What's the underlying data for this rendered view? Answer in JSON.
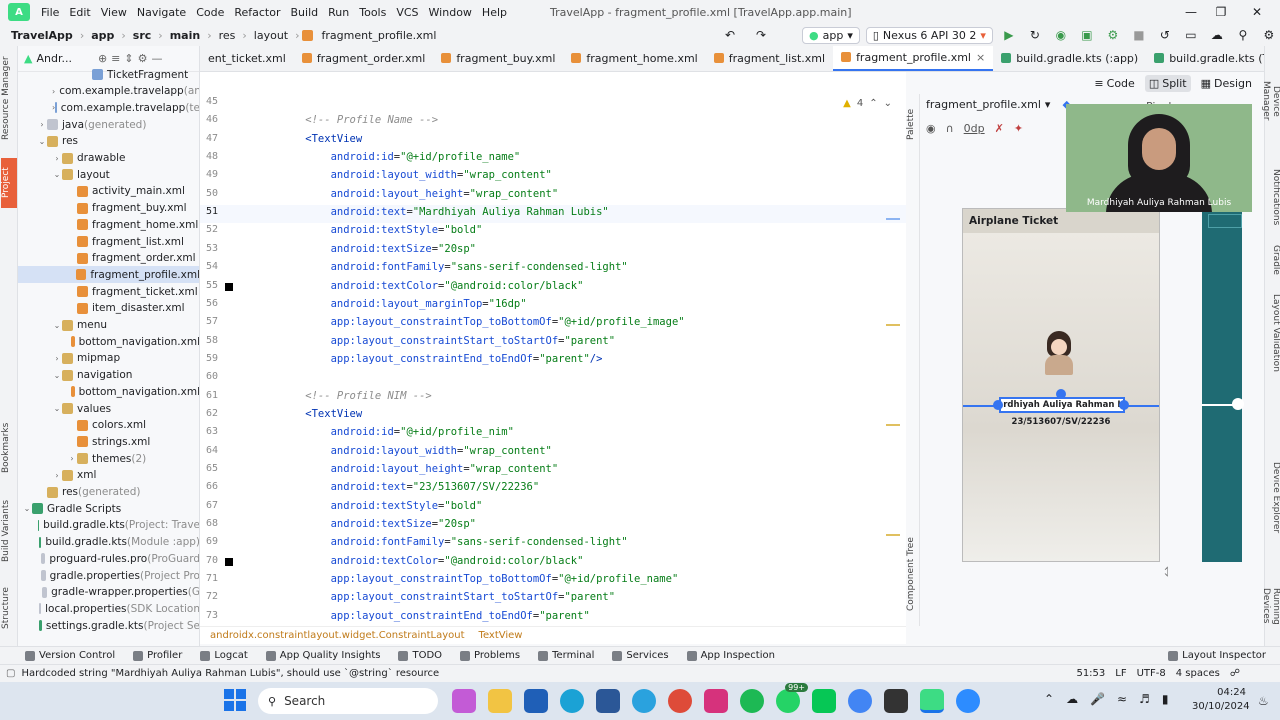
{
  "menubar": {
    "logo": "A",
    "items": [
      "File",
      "Edit",
      "View",
      "Navigate",
      "Code",
      "Refactor",
      "Build",
      "Run",
      "Tools",
      "VCS",
      "Window",
      "Help"
    ],
    "title": "TravelApp - fragment_profile.xml [TravelApp.app.main]"
  },
  "navbar": {
    "crumbs": [
      "TravelApp",
      "app",
      "src",
      "main",
      "res",
      "layout",
      "fragment_profile.xml"
    ],
    "run_config": "app",
    "device": "Nexus 6 API 30 2"
  },
  "project_panel": {
    "title": "Andr...",
    "rows": [
      {
        "label": "TicketFragment",
        "indent": 4,
        "icon": "pkg",
        "arrow": ""
      },
      {
        "label": "com.example.travelapp",
        "suffix": " (an",
        "indent": 2,
        "icon": "pkg",
        "arrow": ">"
      },
      {
        "label": "com.example.travelapp",
        "suffix": " (te",
        "indent": 2,
        "icon": "pkg",
        "arrow": ">"
      },
      {
        "label": "java",
        "suffix": " (generated)",
        "indent": 1,
        "icon": "javaf",
        "arrow": ">"
      },
      {
        "label": "res",
        "indent": 1,
        "icon": "folder",
        "arrow": "v"
      },
      {
        "label": "drawable",
        "indent": 2,
        "icon": "folder",
        "arrow": ">"
      },
      {
        "label": "layout",
        "indent": 2,
        "icon": "folder",
        "arrow": "v"
      },
      {
        "label": "activity_main.xml",
        "indent": 3,
        "icon": "xmlf",
        "arrow": ""
      },
      {
        "label": "fragment_buy.xml",
        "indent": 3,
        "icon": "xmlf",
        "arrow": ""
      },
      {
        "label": "fragment_home.xml",
        "indent": 3,
        "icon": "xmlf",
        "arrow": ""
      },
      {
        "label": "fragment_list.xml",
        "indent": 3,
        "icon": "xmlf",
        "arrow": ""
      },
      {
        "label": "fragment_order.xml",
        "indent": 3,
        "icon": "xmlf",
        "arrow": ""
      },
      {
        "label": "fragment_profile.xml",
        "indent": 3,
        "icon": "xmlf",
        "arrow": "",
        "selected": true
      },
      {
        "label": "fragment_ticket.xml",
        "indent": 3,
        "icon": "xmlf",
        "arrow": ""
      },
      {
        "label": "item_disaster.xml",
        "indent": 3,
        "icon": "xmlf",
        "arrow": ""
      },
      {
        "label": "menu",
        "indent": 2,
        "icon": "folder",
        "arrow": "v"
      },
      {
        "label": "bottom_navigation.xml",
        "indent": 3,
        "icon": "xmlf",
        "arrow": ""
      },
      {
        "label": "mipmap",
        "indent": 2,
        "icon": "folder",
        "arrow": ">"
      },
      {
        "label": "navigation",
        "indent": 2,
        "icon": "folder",
        "arrow": "v"
      },
      {
        "label": "bottom_navigation.xml",
        "indent": 3,
        "icon": "xmlf",
        "arrow": ""
      },
      {
        "label": "values",
        "indent": 2,
        "icon": "folder",
        "arrow": "v"
      },
      {
        "label": "colors.xml",
        "indent": 3,
        "icon": "xmlf",
        "arrow": ""
      },
      {
        "label": "strings.xml",
        "indent": 3,
        "icon": "xmlf",
        "arrow": ""
      },
      {
        "label": "themes",
        "suffix": " (2)",
        "indent": 3,
        "icon": "folder",
        "arrow": ">"
      },
      {
        "label": "xml",
        "indent": 2,
        "icon": "folder",
        "arrow": ">"
      },
      {
        "label": "res",
        "suffix": " (generated)",
        "indent": 1,
        "icon": "folder",
        "arrow": ""
      },
      {
        "label": "Gradle Scripts",
        "indent": 0,
        "icon": "gradlef",
        "arrow": "v"
      },
      {
        "label": "build.gradle.kts",
        "suffix": " (Project: Trave",
        "indent": 1,
        "icon": "gradlef",
        "arrow": ""
      },
      {
        "label": "build.gradle.kts",
        "suffix": " (Module :app)",
        "indent": 1,
        "icon": "gradlef",
        "arrow": ""
      },
      {
        "label": "proguard-rules.pro",
        "suffix": " (ProGuard",
        "indent": 1,
        "icon": "javaf",
        "arrow": ""
      },
      {
        "label": "gradle.properties",
        "suffix": " (Project Pro",
        "indent": 1,
        "icon": "javaf",
        "arrow": ""
      },
      {
        "label": "gradle-wrapper.properties",
        "suffix": " (G",
        "indent": 1,
        "icon": "javaf",
        "arrow": ""
      },
      {
        "label": "local.properties",
        "suffix": " (SDK Location",
        "indent": 1,
        "icon": "javaf",
        "arrow": ""
      },
      {
        "label": "settings.gradle.kts",
        "suffix": " (Project Se",
        "indent": 1,
        "icon": "gradlef",
        "arrow": ""
      }
    ]
  },
  "left_strip": [
    "Resource Manager",
    "Project",
    "Bookmarks",
    "Build Variants",
    "Structure"
  ],
  "right_strip": [
    "Device Manager",
    "Notifications",
    "Gradle",
    "Layout Validation",
    "Device Explorer",
    "Running Devices"
  ],
  "tabs": [
    "ent_ticket.xml",
    "fragment_order.xml",
    "fragment_buy.xml",
    "fragment_home.xml",
    "fragment_list.xml",
    "fragment_profile.xml",
    "build.gradle.kts (:app)",
    "build.gradle.kts (TravelApp)"
  ],
  "active_tab": 5,
  "editor": {
    "warning_count": "4",
    "lines": [
      {
        "n": "45",
        "t": ""
      },
      {
        "n": "46",
        "t": "    <!-- Profile Name -->",
        "k": "cmt"
      },
      {
        "n": "47",
        "t": "    <TextView",
        "k": "tag"
      },
      {
        "n": "48",
        "t": "        android:id=\"@+id/profile_name\""
      },
      {
        "n": "49",
        "t": "        android:layout_width=\"wrap_content\""
      },
      {
        "n": "50",
        "t": "        android:layout_height=\"wrap_content\""
      },
      {
        "n": "51",
        "t": "        android:text=\"Mardhiyah Auliya Rahman Lubis\"",
        "cur": true
      },
      {
        "n": "52",
        "t": "        android:textStyle=\"bold\""
      },
      {
        "n": "53",
        "t": "        android:textSize=\"20sp\""
      },
      {
        "n": "54",
        "t": "        android:fontFamily=\"sans-serif-condensed-light\""
      },
      {
        "n": "55",
        "t": "        android:textColor=\"@android:color/black\"",
        "mark": true
      },
      {
        "n": "56",
        "t": "        android:layout_marginTop=\"16dp\""
      },
      {
        "n": "57",
        "t": "        app:layout_constraintTop_toBottomOf=\"@+id/profile_image\""
      },
      {
        "n": "58",
        "t": "        app:layout_constraintStart_toStartOf=\"parent\""
      },
      {
        "n": "59",
        "t": "        app:layout_constraintEnd_toEndOf=\"parent\"/>"
      },
      {
        "n": "60",
        "t": ""
      },
      {
        "n": "61",
        "t": "    <!-- Profile NIM -->",
        "k": "cmt"
      },
      {
        "n": "62",
        "t": "    <TextView",
        "k": "tag"
      },
      {
        "n": "63",
        "t": "        android:id=\"@+id/profile_nim\""
      },
      {
        "n": "64",
        "t": "        android:layout_width=\"wrap_content\""
      },
      {
        "n": "65",
        "t": "        android:layout_height=\"wrap_content\""
      },
      {
        "n": "66",
        "t": "        android:text=\"23/513607/SV/22236\""
      },
      {
        "n": "67",
        "t": "        android:textStyle=\"bold\""
      },
      {
        "n": "68",
        "t": "        android:textSize=\"20sp\""
      },
      {
        "n": "69",
        "t": "        android:fontFamily=\"sans-serif-condensed-light\""
      },
      {
        "n": "70",
        "t": "        android:textColor=\"@android:color/black\"",
        "mark": true
      },
      {
        "n": "71",
        "t": "        app:layout_constraintTop_toBottomOf=\"@+id/profile_name\""
      },
      {
        "n": "72",
        "t": "        app:layout_constraintStart_toStartOf=\"parent\""
      },
      {
        "n": "73",
        "t": "        app:layout_constraintEnd_toEndOf=\"parent\""
      }
    ],
    "breadcrumb": [
      "androidx.constraintlayout.widget.ConstraintLayout",
      "TextView"
    ]
  },
  "design": {
    "modes": [
      "Code",
      "Split",
      "Design"
    ],
    "active_mode": "Split",
    "file_select": "fragment_profile.xml",
    "margin": "0dp",
    "pixel": "Pixel",
    "palette": "Palette",
    "component_tree": "Component Tree",
    "phone_title": "Airplane Ticket",
    "profile_name_preview": "Mardhiyah Auliya Rahman Lub",
    "profile_nim_preview": "23/513607/SV/22236"
  },
  "webcam": {
    "name": "Mardhiyah Auliya Rahman Lubis"
  },
  "bottom_tools": [
    "Version Control",
    "Profiler",
    "Logcat",
    "App Quality Insights",
    "TODO",
    "Problems",
    "Terminal",
    "Services",
    "App Inspection"
  ],
  "layout_inspector": "Layout Inspector",
  "status": {
    "message": "Hardcoded string \"Mardhiyah Auliya Rahman Lubis\", should use `@string` resource",
    "position": "51:53",
    "line_sep": "LF",
    "encoding": "UTF-8",
    "indent": "4 spaces"
  },
  "taskbar": {
    "search": "Search",
    "time": "04:24",
    "date": "30/10/2024",
    "badge": "99+"
  },
  "colors": {
    "accent": "#3574f0",
    "tag": "#0033b3",
    "string": "#067d17",
    "comment": "#8c8c8c"
  }
}
